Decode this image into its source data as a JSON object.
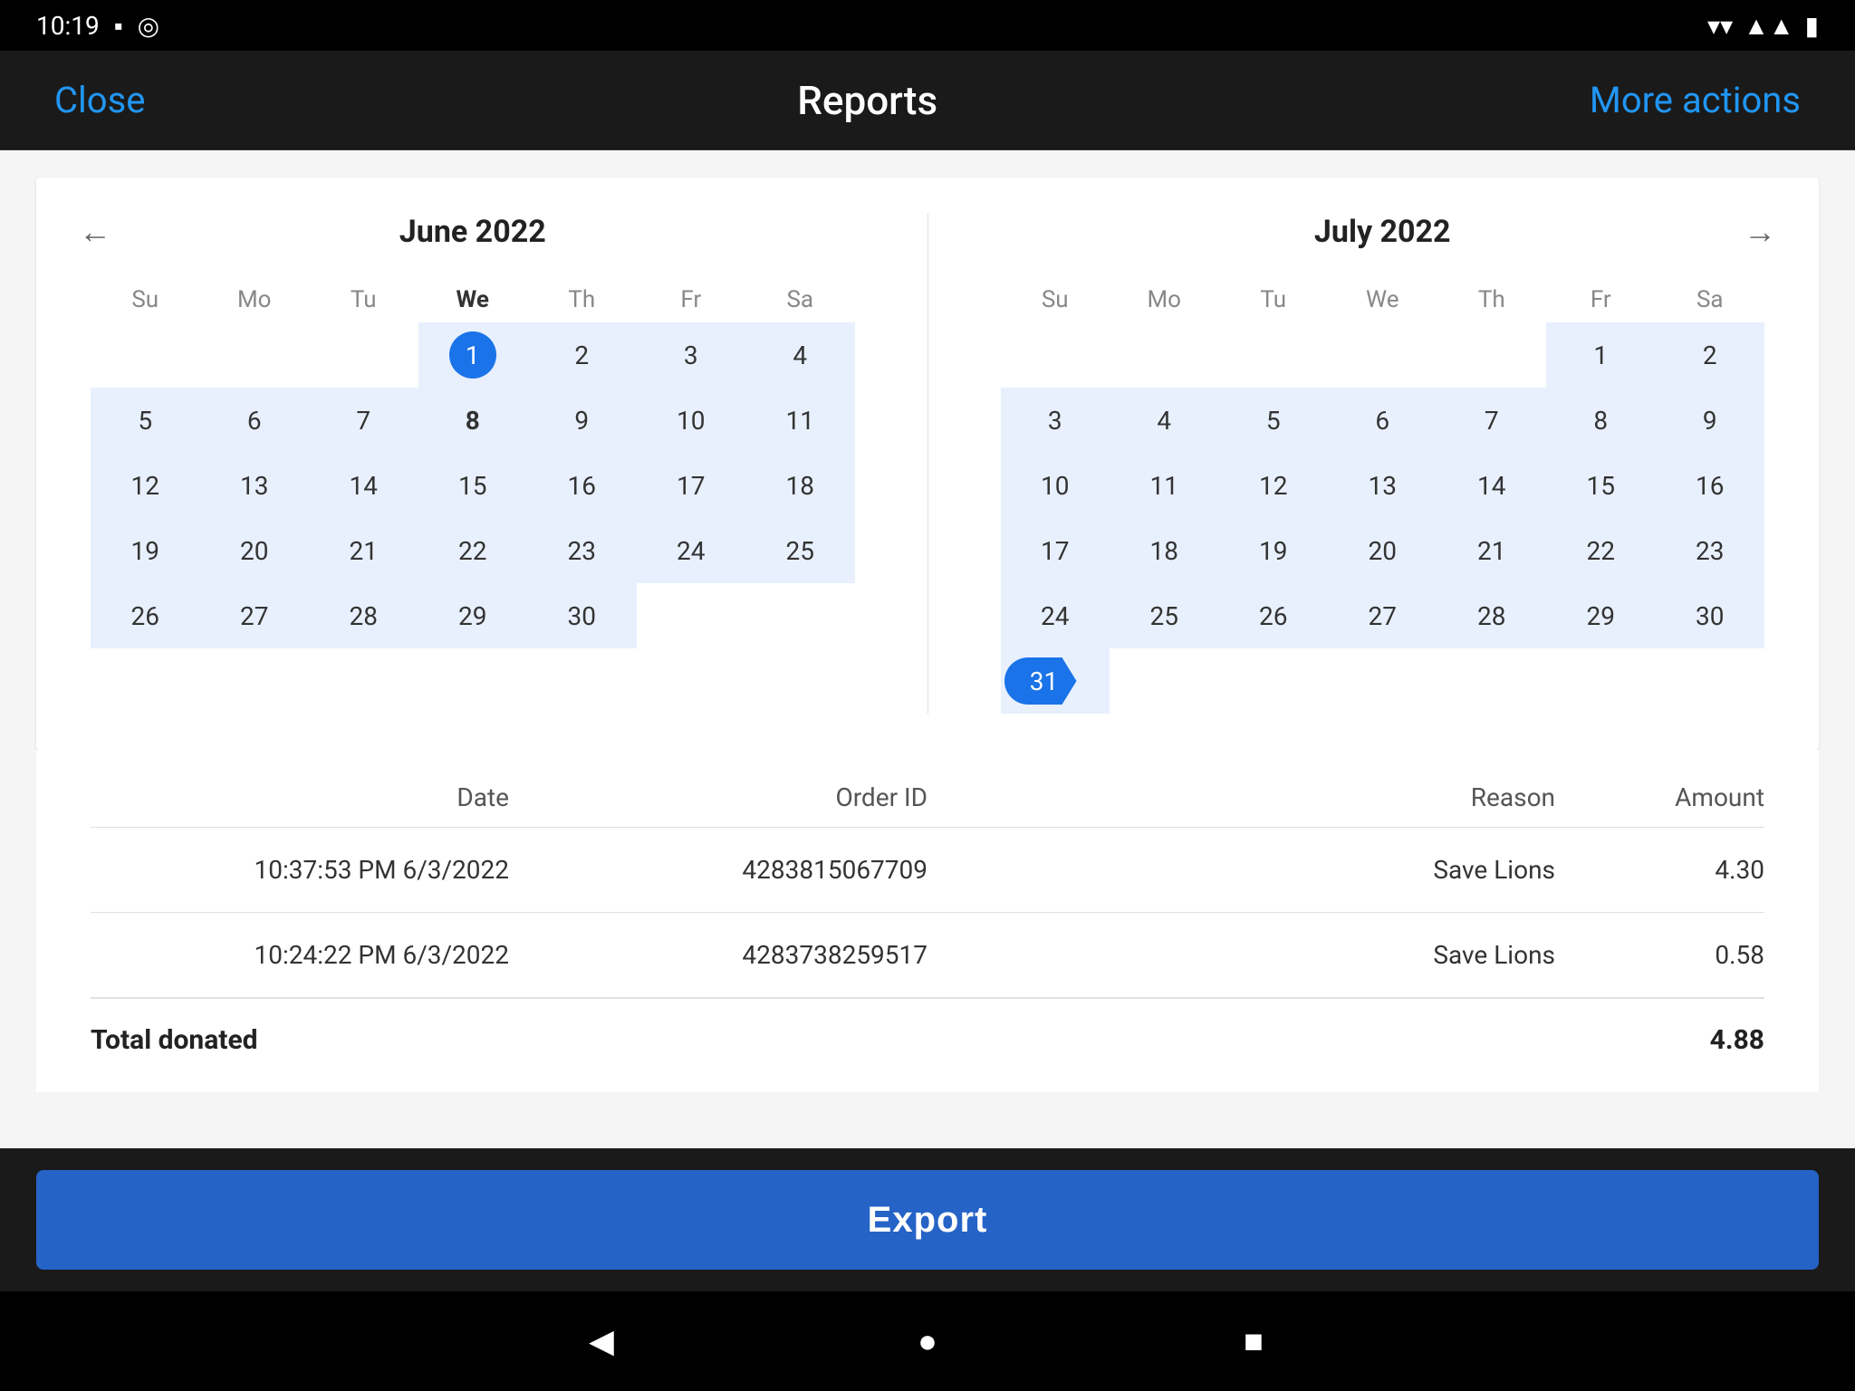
{
  "statusBar": {
    "time": "10:19",
    "icons": [
      "sim",
      "target"
    ]
  },
  "navBar": {
    "close_label": "Close",
    "title": "Reports",
    "more_label": "More actions"
  },
  "calendar": {
    "june": {
      "title": "June 2022",
      "dayHeaders": [
        "Su",
        "Mo",
        "Tu",
        "We",
        "Th",
        "Fr",
        "Sa"
      ],
      "boldHeader": "We",
      "weeks": [
        [
          "",
          "",
          "",
          "1",
          "2",
          "3",
          "4"
        ],
        [
          "5",
          "6",
          "7",
          "8",
          "9",
          "10",
          "11"
        ],
        [
          "12",
          "13",
          "14",
          "15",
          "16",
          "17",
          "18"
        ],
        [
          "19",
          "20",
          "21",
          "22",
          "23",
          "24",
          "25"
        ],
        [
          "26",
          "27",
          "28",
          "29",
          "30",
          "",
          ""
        ]
      ],
      "selectedStart": "1",
      "boldDay": "8",
      "rangeStart": "1",
      "rangeEnd": "30"
    },
    "july": {
      "title": "July 2022",
      "dayHeaders": [
        "Su",
        "Mo",
        "Tu",
        "We",
        "Th",
        "Fr",
        "Sa"
      ],
      "weeks": [
        [
          "",
          "",
          "",
          "",
          "",
          "1",
          "2"
        ],
        [
          "3",
          "4",
          "5",
          "6",
          "7",
          "8",
          "9"
        ],
        [
          "10",
          "11",
          "12",
          "13",
          "14",
          "15",
          "16"
        ],
        [
          "17",
          "18",
          "19",
          "20",
          "21",
          "22",
          "23"
        ],
        [
          "24",
          "25",
          "26",
          "27",
          "28",
          "29",
          "30"
        ],
        [
          "31",
          "",
          "",
          "",
          "",
          "",
          ""
        ]
      ],
      "selectedEnd": "31",
      "rangeInMonth": true
    }
  },
  "table": {
    "headers": [
      "Date",
      "Order ID",
      "Reason",
      "Amount"
    ],
    "rows": [
      {
        "date": "10:37:53 PM 6/3/2022",
        "orderId": "4283815067709",
        "reason": "Save Lions",
        "amount": "4.30"
      },
      {
        "date": "10:24:22 PM 6/3/2022",
        "orderId": "4283738259517",
        "reason": "Save Lions",
        "amount": "0.58"
      }
    ],
    "total_label": "Total donated",
    "total_amount": "4.88"
  },
  "exportButton": {
    "label": "Export"
  },
  "bottomNav": {
    "back": "◀",
    "home": "●",
    "recent": "■"
  }
}
